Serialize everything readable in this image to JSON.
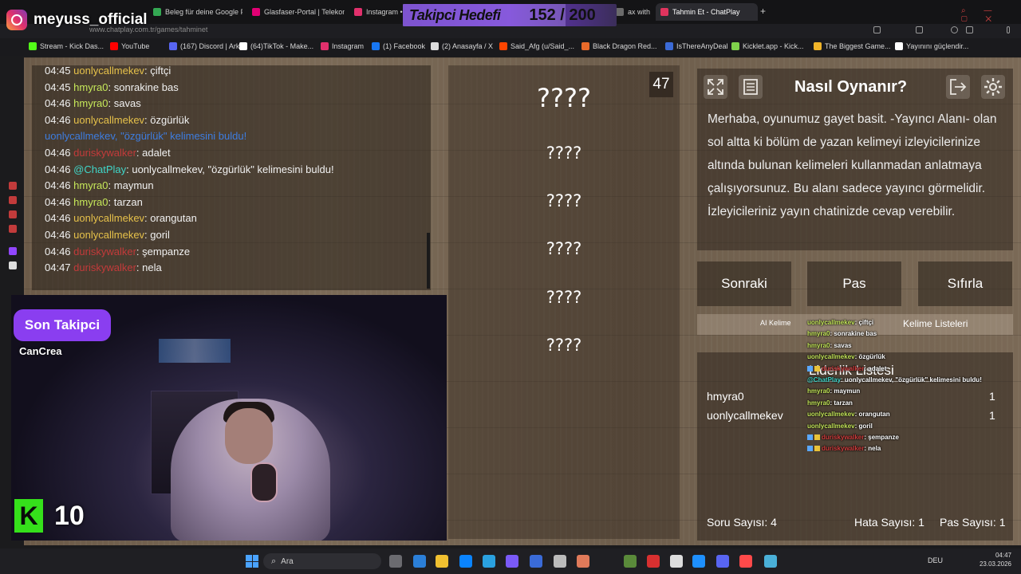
{
  "browser": {
    "tabs": [
      {
        "label": "Beleg für deine Google Pl",
        "color": "#34a853"
      },
      {
        "label": "Glasfaser-Portal | Telekom",
        "color": "#e20074"
      },
      {
        "label": "Instagram •",
        "color": "#e1306c"
      },
      {
        "label": "ax with G",
        "color": "#6b6b6b"
      },
      {
        "label": "Tahmin Et - ChatPlay",
        "color": "#e0345e"
      }
    ],
    "new_tab": "+",
    "url": "www.chatplay.com.tr/games/tahminet",
    "bookmarks": [
      {
        "label": "Stream - Kick Das...",
        "color": "#53fc18"
      },
      {
        "label": "YouTube",
        "color": "#ff0000"
      },
      {
        "label": "(167) Discord | Ark...",
        "color": "#5865f2"
      },
      {
        "label": "(64)TikTok - Make...",
        "color": "#ffffff"
      },
      {
        "label": "Instagram",
        "color": "#e1306c"
      },
      {
        "label": "(1) Facebook",
        "color": "#1877f2"
      },
      {
        "label": "(2) Anasayfa / X",
        "color": "#dddddd"
      },
      {
        "label": "Said_Afg (u/Said_...",
        "color": "#ff4500"
      },
      {
        "label": "Black Dragon Red...",
        "color": "#e86a2a"
      },
      {
        "label": "IsThereAnyDeal",
        "color": "#3b6ad6"
      },
      {
        "label": "Kicklet.app - Kick...",
        "color": "#7fd14b"
      },
      {
        "label": "The Biggest Game...",
        "color": "#f0b429"
      },
      {
        "label": "Yayınını güçlendir...",
        "color": "#ffffff"
      }
    ]
  },
  "stream": {
    "channel": "meyuss_official",
    "follow_goal": {
      "label": "Takipci Hedefi",
      "count": "152 / 200",
      "progress": 0.76
    },
    "last_follower": {
      "title": "Son Takipci",
      "name": "CanCrea"
    },
    "k_badge": "K",
    "k_count": "10"
  },
  "chat": {
    "messages": [
      {
        "time": "04:45",
        "user": "uonlycallmekev",
        "ucolor": "u-yellow",
        "text": ": çiftçi"
      },
      {
        "time": "04:45",
        "user": "hmyra0",
        "ucolor": "u-lime",
        "text": ": sonrakine bas"
      },
      {
        "time": "04:46",
        "user": "hmyra0",
        "ucolor": "u-lime",
        "text": ": savas"
      },
      {
        "time": "04:46",
        "user": "uonlycallmekev",
        "ucolor": "u-yellow",
        "text": ": özgürlük"
      },
      {
        "time": "",
        "user": "uonlycallmekev, \"özgürlük\" kelimesini buldu!",
        "ucolor": "u-blue",
        "text": ""
      },
      {
        "time": "04:46",
        "user": "duriskywalker",
        "ucolor": "u-red",
        "text": ": adalet"
      },
      {
        "time": "04:46",
        "user": "@ChatPlay",
        "ucolor": "u-cyan",
        "text": ": uonlycallmekev, \"özgürlük\" kelimesini buldu!"
      },
      {
        "time": "04:46",
        "user": "hmyra0",
        "ucolor": "u-lime",
        "text": ": maymun"
      },
      {
        "time": "04:46",
        "user": "hmyra0",
        "ucolor": "u-lime",
        "text": ": tarzan"
      },
      {
        "time": "04:46",
        "user": "uonlycallmekev",
        "ucolor": "u-yellow",
        "text": ": orangutan"
      },
      {
        "time": "04:46",
        "user": "uonlycallmekev",
        "ucolor": "u-yellow",
        "text": ": goril"
      },
      {
        "time": "04:46",
        "user": "duriskywalker",
        "ucolor": "u-red",
        "text": ": şempanze"
      },
      {
        "time": "04:47",
        "user": "duriskywalker",
        "ucolor": "u-red",
        "text": ": nela"
      }
    ]
  },
  "game": {
    "timer": "47",
    "hidden_words": [
      "????",
      "????",
      "????",
      "????",
      "????",
      "????"
    ],
    "how_to": {
      "title": "Nasıl Oynanır?",
      "text": "Merhaba, oyunumuz gayet basit. -Yayıncı Alanı- olan sol altta ki bölüm de yazan kelimeyi izleyicilerinize altında bulunan kelimeleri kullanmadan anlatmaya çalışıyorsunuz. Bu alanı sadece yayıncı görmelidir. İzleyicileriniz yayın chatinizde cevap verebilir."
    },
    "actions": {
      "next": "Sonraki",
      "pass": "Pas",
      "reset": "Sıfırla"
    },
    "tabs": {
      "ai": "AI Kelime",
      "word_lists": "Kelime Listeleri"
    },
    "leaderboard": {
      "title": "Liderlik Listesi",
      "rows": [
        {
          "name": "hmyra0",
          "score": "1"
        },
        {
          "name": "uonlycallmekev",
          "score": "1"
        }
      ]
    },
    "stats": {
      "questions": "Soru Sayısı: 4",
      "mistakes": "Hata Sayısı: 1",
      "passes": "Pas Sayısı: 1"
    }
  },
  "overlay_chat": [
    {
      "user": "uonlycallmekev",
      "cls": "n",
      "text": ": çiftçi",
      "badge": false
    },
    {
      "user": "hmyra0",
      "cls": "n",
      "text": ": sonrakine bas",
      "badge": false
    },
    {
      "user": "hmyra0",
      "cls": "n",
      "text": ": savas",
      "badge": false
    },
    {
      "user": "uonlycallmekev",
      "cls": "n",
      "text": ": özgürlük",
      "badge": false
    },
    {
      "user": "duriskywalker",
      "cls": "r",
      "text": ": adalet",
      "badge": true
    },
    {
      "user": "@ChatPlay",
      "cls": "c",
      "text": ": uonlycallmekev, \"özgürlük\" kelimesini buldu!",
      "badge": false
    },
    {
      "user": "hmyra0",
      "cls": "n",
      "text": ": maymun",
      "badge": false
    },
    {
      "user": "hmyra0",
      "cls": "n",
      "text": ": tarzan",
      "badge": false
    },
    {
      "user": "uonlycallmekev",
      "cls": "n",
      "text": ": orangutan",
      "badge": false
    },
    {
      "user": "uonlycallmekev",
      "cls": "n",
      "text": ": goril",
      "badge": false
    },
    {
      "user": "duriskywalker",
      "cls": "r",
      "text": ": şempanze",
      "badge": true
    },
    {
      "user": "duriskywalker",
      "cls": "r",
      "text": ": nela",
      "badge": true
    }
  ],
  "taskbar": {
    "search_placeholder": "Ara",
    "language": "DEU",
    "time": "04:47",
    "date": "23.03.2026"
  }
}
